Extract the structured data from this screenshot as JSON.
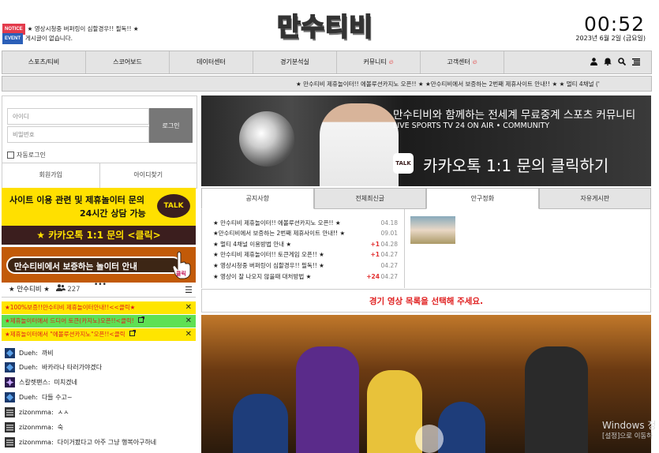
{
  "notices": [
    {
      "badge": "NOTICE",
      "badge_color": "#e33b4c",
      "text": "★ 영상시청중 버퍼링이 심할경우!! 필독!! ★"
    },
    {
      "badge": "EVENT",
      "badge_color": "#2b5fb8",
      "text": "게시글이 없습니다."
    }
  ],
  "logo": "만수티비",
  "clock": {
    "time": "00:52",
    "date": "2023년 6월 2일 (금요일)"
  },
  "nav": {
    "items": [
      "스포츠/티비",
      "스코어보드",
      "데이터센터",
      "경기분석실",
      "커뮤니티",
      "고객센터"
    ],
    "flame_items": [
      4,
      5
    ],
    "icons": [
      "user-icon",
      "bell-icon",
      "search-icon",
      "menu-icon"
    ]
  },
  "marquee": "★ 만수티비 제휴놀이터!! 에볼루션카지노 오픈!! ★ ★만수티비에서 보증하는 2번째 제휴사이트 안내!! ★ ★ 멀티 4채널 ('",
  "login": {
    "id_placeholder": "아이디",
    "pw_placeholder": "비밀번호",
    "login_button": "로그인",
    "auto_login": "자동로그인",
    "join": "회원가입",
    "find_id": "아이디찾기"
  },
  "banner1": {
    "line1": "사이트 이용 관련 및 제휴놀이터 문의",
    "line2": "24시간 상담 가능",
    "talk": "TALK",
    "bar": "★ 카카오톡 1:1 문의 <클릭>"
  },
  "banner2": {
    "text": "만수티비에서 보증하는 놀이터 안내",
    "click": "클릭"
  },
  "chat": {
    "room": "★ 만수티비 ★",
    "count": "227",
    "notices": [
      {
        "text": "★100%보증!!만수티비 제휴놀이터안내!!<<클릭★",
        "bg": "#ffe500",
        "color": "#e01e1e"
      },
      {
        "text": "★제휴놀이터에서 드디어 토큰(카지노)오픈!!<클릭!",
        "bg": "#5ee054",
        "color": "#e01e1e"
      },
      {
        "text": "★제휴놀이터에서 \"에볼루션카지노\"오픈!!<클릭",
        "bg": "#ffe500",
        "color": "#e01e1e"
      }
    ],
    "messages": [
      {
        "name": "Dueh",
        "text": "까비",
        "avatar": "blue"
      },
      {
        "name": "Dueh",
        "text": "바카라나 타러가야겠다",
        "avatar": "blue"
      },
      {
        "name": "스칼렛팬스",
        "text": "미치겠네",
        "avatar": "purple"
      },
      {
        "name": "Dueh",
        "text": "다들 수고~",
        "avatar": "blue"
      },
      {
        "name": "zizonmma",
        "text": "ㅅㅅ",
        "avatar": "gray"
      },
      {
        "name": "zizonmma",
        "text": "숙",
        "avatar": "gray"
      },
      {
        "name": "zizonmma",
        "text": "다이거봤다고 아주 그냥 행복아구하네",
        "avatar": "gray"
      }
    ]
  },
  "main_banner": {
    "headline": "만수티비와 함께하는 전세계 무료중계 스포츠 커뮤니티",
    "subline": "LIVE SPORTS TV 24 ON AIR • COMMUNITY",
    "talk_badge": "TALK",
    "cta": "카카오톡 1:1 문의 클릭하기"
  },
  "tabs": [
    "공지사항",
    "전체최신글",
    "안구정화",
    "자유게시판"
  ],
  "posts": [
    {
      "title": "★ 만수티비 제휴놀이터!! 에볼루션카지노 오픈!! ★",
      "plus": "",
      "date": "04.18"
    },
    {
      "title": "★만수티비에서 보증하는 2번째 제휴사이트 안내!! ★",
      "plus": "",
      "date": "09.01"
    },
    {
      "title": "★ 멀티 4채널 이용방법 안내 ★",
      "plus": "+1",
      "date": "04.28"
    },
    {
      "title": "★ 만수티비 제휴놀이터!! 토큰게임 오픈!! ★",
      "plus": "+1",
      "date": "04.27"
    },
    {
      "title": "★ 영상시청중 버퍼링이 심할경우!! 필독!! ★",
      "plus": "",
      "date": "04.27"
    },
    {
      "title": "★ 영상이 잘 나오지 않을때 대처방법 ★",
      "plus": "+24",
      "date": "04.27"
    }
  ],
  "select_message": "경기 영상 목록을 선택해 주세요.",
  "windows_watermark": {
    "line1": "Windows 정",
    "line2": "[설정]으로 이동하"
  }
}
